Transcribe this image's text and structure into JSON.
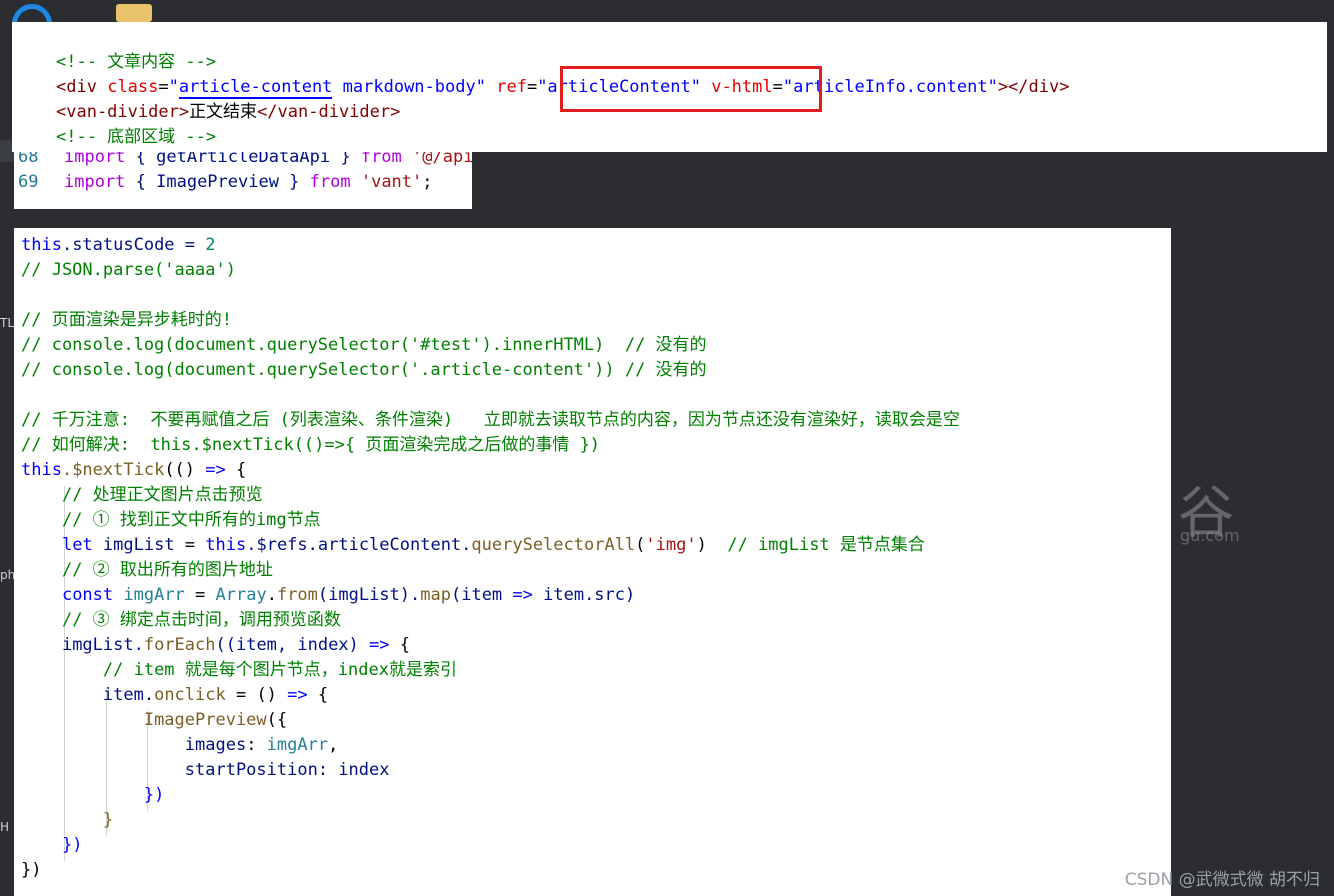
{
  "backdrop": {
    "side_labels": [
      "TL",
      "ph",
      "H"
    ],
    "logo_text": "谷",
    "domain_text": "gu.com"
  },
  "panel1": {
    "line1": "<!-- 文章内容 -->",
    "line2": {
      "open": "<div",
      "class_attr": "class",
      "eq1": "=",
      "q1": "\"",
      "class_underlined": "article-content",
      "class_rest": " markdown-body",
      "q2": "\"",
      "ref_attr": "ref",
      "eq2": "=",
      "ref_val": "\"articleContent\"",
      "vhtml_attr": "v-html",
      "eq3": "=",
      "vhtml_val": "\"articleInfo.content\"",
      "close": "></div>"
    },
    "line3": {
      "open": "<van-divider>",
      "text": "正文结束",
      "close": "</van-divider>"
    },
    "line4": "<!-- 底部区域 -->"
  },
  "panel2": {
    "lines": [
      {
        "num": "68",
        "kw": "import",
        "body": " { getArticleDataApi } ",
        "from": "from",
        "str": " '@/api"
      },
      {
        "num": "69",
        "kw": "import",
        "body": " { ImagePreview } ",
        "from": "from",
        "str": " 'vant'",
        "end": ";"
      }
    ]
  },
  "panel3": {
    "l01a": "this",
    "l01b": ".statusCode = ",
    "l01c": "2",
    "l02": "// JSON.parse('aaaa')",
    "l04": "// 页面渲染是异步耗时的!",
    "l05": "// console.log(document.querySelector('#test').innerHTML)  // 没有的",
    "l06": "// console.log(document.querySelector('.article-content')) // 没有的",
    "l08": "// 千万注意:  不要再赋值之后 (列表渲染、条件渲染)   立即就去读取节点的内容，因为节点还没有渲染好，读取会是空",
    "l09": "// 如何解决:  this.$nextTick(()=>{ 页面渲染完成之后做的事情 })",
    "l10a": "this",
    "l10b": ".$nextTick",
    "l10c": "(() ",
    "l10d": "=>",
    "l10e": " {",
    "l11": "// 处理正文图片点击预览",
    "l12": "// ① 找到正文中所有的img节点",
    "l13a": "let",
    "l13b": " imgList",
    "l13c": " = ",
    "l13d": "this",
    "l13e": ".$refs.articleContent.",
    "l13f": "querySelectorAll",
    "l13g": "(",
    "l13h": "'img'",
    "l13i": ")",
    "l13j": "  // imgList 是节点集合",
    "l14": "// ② 取出所有的图片地址",
    "l15a": "const",
    "l15b": " imgArr",
    "l15c": " = ",
    "l15d": "Array",
    "l15e": ".",
    "l15f": "from",
    "l15g": "(imgList).",
    "l15h": "map",
    "l15i": "(item ",
    "l15j": "=>",
    "l15k": " item.src)",
    "l16": "// ③ 绑定点击时间，调用预览函数",
    "l17a": "imgList.",
    "l17b": "forEach",
    "l17c": "((item, index) ",
    "l17d": "=>",
    "l17e": " {",
    "l18": "// item 就是每个图片节点，index就是索引",
    "l19a": "item.",
    "l19b": "onclick",
    "l19c": " = () ",
    "l19d": "=>",
    "l19e": " {",
    "l20a": "ImagePreview",
    "l20b": "({",
    "l21a": "images",
    "l21b": ": ",
    "l21c": "imgArr",
    "l21d": ",",
    "l22a": "startPosition",
    "l22b": ": index",
    "l23": "})",
    "l24": "}",
    "l25": "})",
    "l26": "})"
  },
  "watermark": "CSDN @武微式微   胡不归"
}
